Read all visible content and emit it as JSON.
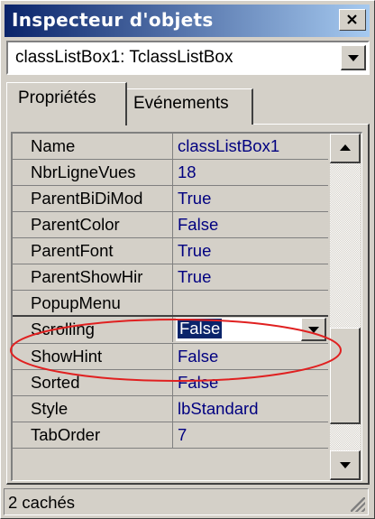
{
  "window": {
    "title": "Inspecteur d'objets",
    "selected_object": "classListBox1: TclassListBox",
    "title_gradient_start": "#0a246a",
    "title_gradient_end": "#a6caf0"
  },
  "tabs": [
    {
      "label": "Propriétés",
      "active": true
    },
    {
      "label": "Evénements",
      "active": false
    }
  ],
  "properties": [
    {
      "name": "Name",
      "value": "classListBox1"
    },
    {
      "name": "NbrLigneVues",
      "value": "18"
    },
    {
      "name": "ParentBiDiMod",
      "value": "True"
    },
    {
      "name": "ParentColor",
      "value": "False"
    },
    {
      "name": "ParentFont",
      "value": "True"
    },
    {
      "name": "ParentShowHir",
      "value": "True"
    },
    {
      "name": "PopupMenu",
      "value": ""
    },
    {
      "name": "Scrolling",
      "value": "False",
      "selected": true
    },
    {
      "name": "ShowHint",
      "value": "False"
    },
    {
      "name": "Sorted",
      "value": "False"
    },
    {
      "name": "Style",
      "value": "lbStandard"
    },
    {
      "name": "TabOrder",
      "value": "7"
    }
  ],
  "status": {
    "text": "2 cachés"
  },
  "colors": {
    "value_text": "#000080",
    "selection": "#0a246a",
    "annotation": "#e02020"
  },
  "icons": {
    "close": "close-icon",
    "dropdown": "chevron-down-icon",
    "scroll_up": "scroll-up-arrow-icon",
    "scroll_down": "scroll-down-arrow-icon",
    "size_grip": "size-grip-icon"
  }
}
